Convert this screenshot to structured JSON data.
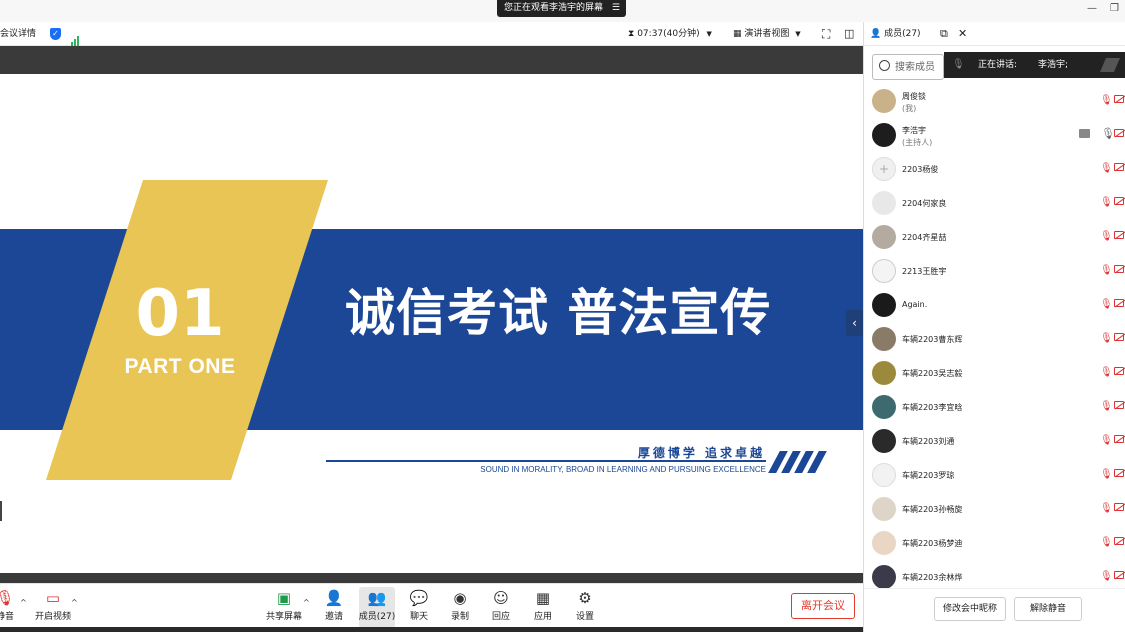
{
  "share_banner": {
    "text": "您正在观看李浩宇的屏幕"
  },
  "toolbar": {
    "meeting_info_label": "会议详情",
    "timer": "07:37(40分钟)",
    "view_mode_label": "演讲者视图"
  },
  "slide": {
    "part_number": "01",
    "part_label": "PART ONE",
    "title": "诚信考试 普法宣传",
    "slogan_cn": "厚德博学 追求卓越",
    "slogan_en": "SOUND IN MORALITY, BROAD IN LEARNING AND PURSUING EXCELLENCE",
    "colors": {
      "blue": "#1b4796",
      "yellow": "#e8c554"
    }
  },
  "controls": {
    "mute_label": "静音",
    "video_label": "开启视频",
    "share_label": "共享屏幕",
    "invite_label": "邀请",
    "members_label": "成员(27)",
    "chat_label": "聊天",
    "record_label": "录制",
    "reply_label": "回应",
    "apps_label": "应用",
    "settings_label": "设置",
    "leave_label": "离开会议"
  },
  "panel": {
    "title": "成员(27)",
    "search_placeholder": "搜索成员",
    "speaking_label": "正在讲话:",
    "speaking_name": "李浩宇;",
    "rename_button": "修改会中昵称",
    "unmute_button": "解除静音"
  },
  "members": [
    {
      "name": "周俊锬",
      "role": "(我)"
    },
    {
      "name": "李浩宇",
      "role": "(主持人)"
    },
    {
      "name": "2203杨俊"
    },
    {
      "name": "2204何家良"
    },
    {
      "name": "2204齐星喆"
    },
    {
      "name": "2213王胜宇"
    },
    {
      "name": "Again."
    },
    {
      "name": "车辆2203曹东辉"
    },
    {
      "name": "车辆2203吴志毅"
    },
    {
      "name": "车辆2203李宜晗"
    },
    {
      "name": "车辆2203刘通"
    },
    {
      "name": "车辆2203罗琼"
    },
    {
      "name": "车辆2203孙畅旋"
    },
    {
      "name": "车辆2203杨梦迪"
    },
    {
      "name": "车辆2203余林烨"
    }
  ],
  "icons": {
    "security": "shield-icon",
    "signal": "signal-icon",
    "timer": "hourglass-icon",
    "view": "grid-icon",
    "fullscreen": "fullscreen-icon",
    "sidebar": "sidebar-icon",
    "members": "person-icon",
    "popout": "popout-icon",
    "close": "close-icon",
    "search": "search-icon",
    "mic_off": "mic-off-icon",
    "video_off": "video-off-icon"
  }
}
